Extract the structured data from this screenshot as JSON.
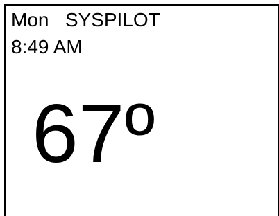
{
  "display": {
    "day": "Mon",
    "mode": "SYSPILOT",
    "time": "8:49 AM",
    "temperature": "67º"
  }
}
